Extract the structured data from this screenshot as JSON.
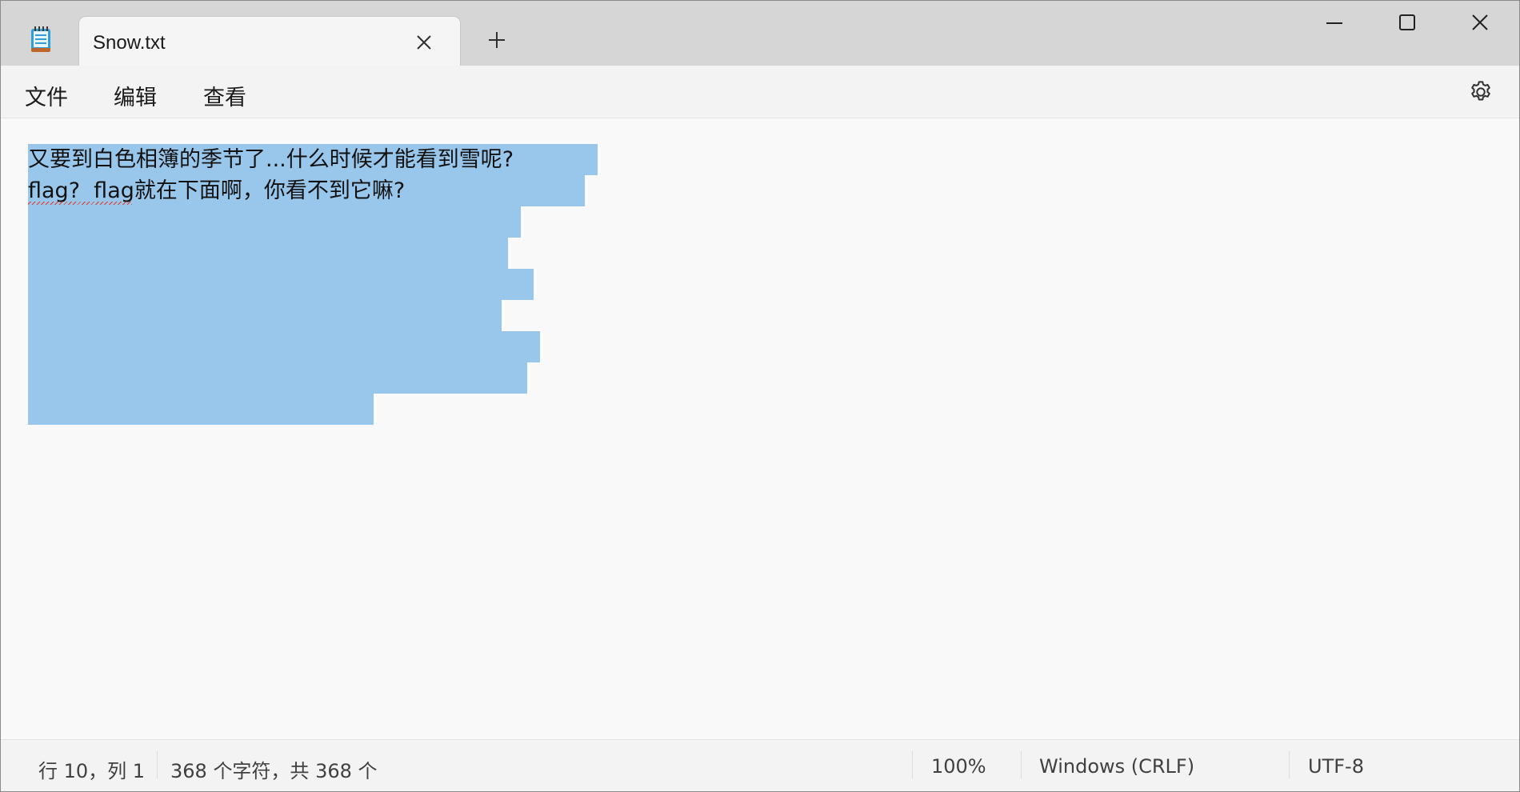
{
  "tab": {
    "title": "Snow.txt"
  },
  "menu": {
    "file": "文件",
    "edit": "编辑",
    "view": "查看"
  },
  "editor": {
    "lines": [
      "又要到白色相簿的季节了...什么时候才能看到雪呢?",
      "flag?  flag就在下面啊，你看不到它嘛?"
    ],
    "selection_color": "#99c7ec"
  },
  "status": {
    "position": "行 10，列 1",
    "chars": "368 个字符，共 368 个",
    "zoom": "100%",
    "line_ending": "Windows (CRLF)",
    "encoding": "UTF-8"
  },
  "icons": {
    "app": "notepad-icon",
    "tab_close": "close-icon",
    "new_tab": "plus-icon",
    "minimize": "minimize-icon",
    "maximize": "maximize-icon",
    "close": "close-icon",
    "settings": "gear-icon"
  }
}
